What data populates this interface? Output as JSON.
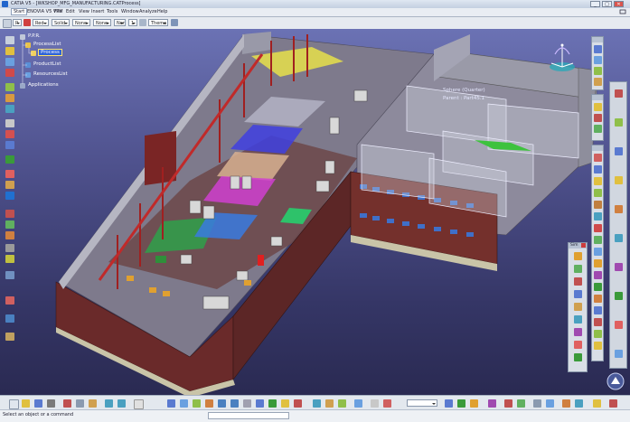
{
  "window": {
    "title": "CATIA V5 - [WKSHOP_MFG_MANUFACTURING.CATProcess]",
    "buttons": {
      "minimize": "_",
      "maximize": "□",
      "close": "✕"
    }
  },
  "menu": {
    "items": [
      "Start",
      "ENOVIA V5 VPM",
      "File",
      "Edit",
      "View",
      "Insert",
      "Tools",
      "Window",
      "Analyze",
      "Help"
    ],
    "active_index": 0
  },
  "toolbar": {
    "combos": [
      {
        "value": "P"
      },
      {
        "value": "Red"
      },
      {
        "value": "Solid"
      },
      {
        "value": "None"
      },
      {
        "value": "None"
      },
      {
        "value": "None"
      },
      {
        "value": "1"
      },
      {
        "value": "Thema"
      }
    ]
  },
  "tree": {
    "nodes": [
      {
        "label": "P.P.R.",
        "icon": "ppr-root-icon",
        "color": "#c0c8d8"
      },
      {
        "label": "ProcessList",
        "icon": "process-list-icon",
        "color": "#e8c24a"
      },
      {
        "label": "Process",
        "icon": "process-icon",
        "color": "#f0d060",
        "selected": true
      },
      {
        "label": "ProductList",
        "icon": "product-list-icon",
        "color": "#5a8fd6"
      },
      {
        "label": "ResourcesList",
        "icon": "resources-list-icon",
        "color": "#6aa0e0"
      },
      {
        "label": "Applications",
        "icon": "applications-icon",
        "color": "#9aa8c8"
      }
    ]
  },
  "viewport": {
    "annotation": [
      "Sphere (Quarter)",
      "Parent : Part45.1"
    ],
    "compass_icon": "compass-icon",
    "logo_icon": "catia-logo-icon"
  },
  "panels": {
    "simulation_title": "Sim"
  },
  "status": {
    "message": "Select an object or a command"
  },
  "colors": {
    "accent": "#2e63d8",
    "selection_outline": "#ffe36a",
    "viewport_top": "#6b72b4",
    "viewport_bottom": "#2a2a52"
  }
}
